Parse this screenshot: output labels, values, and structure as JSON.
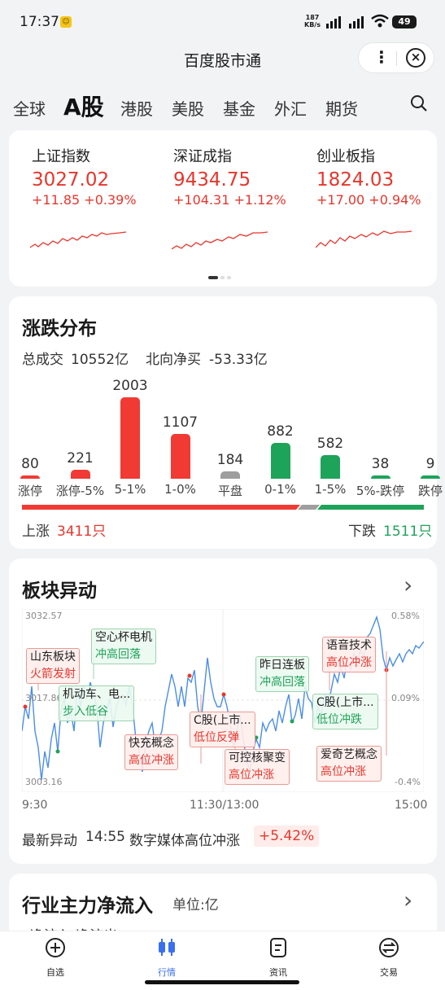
{
  "status": {
    "time": "17:37",
    "net_speed": "187",
    "net_unit": "KB/s",
    "battery": "49"
  },
  "app": {
    "title": "百度股市通"
  },
  "tabs": [
    "全球",
    "A股",
    "港股",
    "美股",
    "基金",
    "外汇",
    "期货"
  ],
  "indices": [
    {
      "name": "上证指数",
      "price": "3027.02",
      "change": "+11.85 +0.39%"
    },
    {
      "name": "深证成指",
      "price": "9434.75",
      "change": "+104.31 +1.12%"
    },
    {
      "name": "创业板指",
      "price": "1824.03",
      "change": "+17.00 +0.94%"
    }
  ],
  "distribution": {
    "title": "涨跌分布",
    "turnover_label": "总成交",
    "turnover": "10552亿",
    "north_label": "北向净买",
    "north": "-53.33亿",
    "bars": [
      {
        "label": "涨停",
        "value": 80,
        "color": "#f03a33"
      },
      {
        "label": "涨停-5%",
        "value": 221,
        "color": "#f03a33"
      },
      {
        "label": "5-1%",
        "value": 2003,
        "color": "#f03a33"
      },
      {
        "label": "1-0%",
        "value": 1107,
        "color": "#f03a33"
      },
      {
        "label": "平盘",
        "value": 184,
        "color": "#9e9e9e"
      },
      {
        "label": "0-1%",
        "value": 882,
        "color": "#1ea35a"
      },
      {
        "label": "1-5%",
        "value": 582,
        "color": "#1ea35a"
      },
      {
        "label": "5%-跌停",
        "value": 38,
        "color": "#1ea35a"
      },
      {
        "label": "跌停",
        "value": 9,
        "color": "#1ea35a"
      }
    ],
    "up_label": "上涨",
    "up_count": "3411只",
    "down_label": "下跌",
    "down_count": "1511只"
  },
  "sector": {
    "title": "板块异动",
    "y_left": [
      "3032.57",
      "3017.86",
      "3003.16"
    ],
    "y_right": [
      "0.58%",
      "0.09%",
      "-0.4%"
    ],
    "x_ticks": [
      "9:30",
      "11:30/13:00",
      "15:00"
    ],
    "labels": [
      {
        "t": "山东板块",
        "s": "火箭发射",
        "c": "red"
      },
      {
        "t": "空心杯电机",
        "s": "冲高回落",
        "c": "grn"
      },
      {
        "t": "机动车、电...",
        "s": "步入低谷",
        "c": "grn"
      },
      {
        "t": "快充概念",
        "s": "高位冲涨",
        "c": "red"
      },
      {
        "t": "C股(上市...",
        "s": "低位反弹",
        "c": "red"
      },
      {
        "t": "可控核聚变",
        "s": "高位冲涨",
        "c": "red"
      },
      {
        "t": "昨日连板",
        "s": "冲高回落",
        "c": "grn"
      },
      {
        "t": "C股(上市...",
        "s": "低位冲跌",
        "c": "grn"
      },
      {
        "t": "语音技术",
        "s": "高位冲涨",
        "c": "red"
      },
      {
        "t": "爱奇艺概念",
        "s": "高位冲涨",
        "c": "red"
      }
    ],
    "latest_label": "最新异动",
    "latest_time": "14:55",
    "latest_text": "数字媒体高位冲涨",
    "latest_change": "+5.42%"
  },
  "inflow": {
    "title": "行业主力净流入",
    "unit": "单位:亿",
    "partial": "净流入  净流出"
  },
  "nav": [
    {
      "label": "自选",
      "icon": "plus-circle-icon"
    },
    {
      "label": "行情",
      "icon": "candlestick-icon"
    },
    {
      "label": "资讯",
      "icon": "news-icon"
    },
    {
      "label": "交易",
      "icon": "exchange-icon"
    }
  ],
  "colors": {
    "red": "#e8362c",
    "green": "#1ea35a",
    "blue": "#3a6ff0"
  }
}
